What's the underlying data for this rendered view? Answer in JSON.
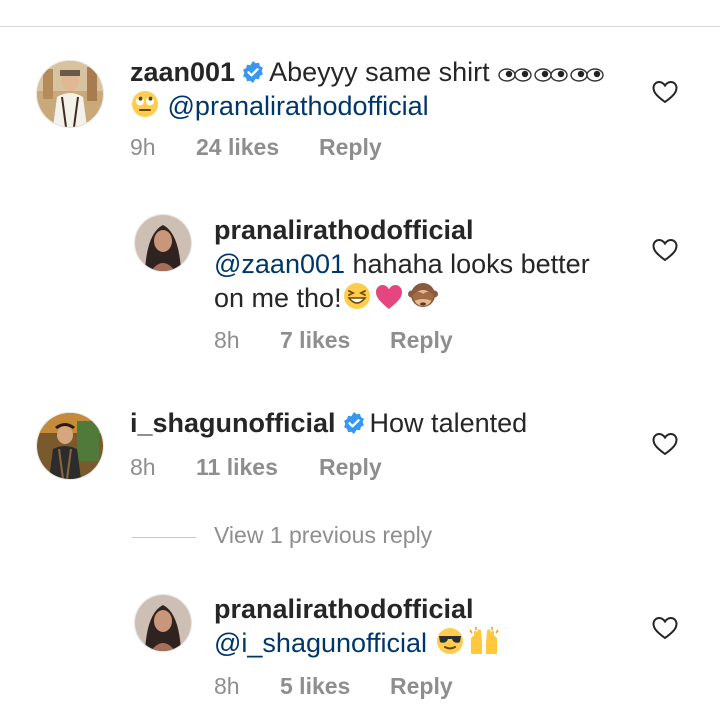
{
  "comments": [
    {
      "username": "zaan001",
      "verified": true,
      "text": "Abeyyy same shirt",
      "text_emojis": [
        "eyes-emoji",
        "eyes-emoji",
        "eyes-emoji"
      ],
      "line2_emoji": "rolling-eyes-emoji",
      "mention": "@pranalirathodofficial",
      "time": "9h",
      "likes": "24 likes",
      "reply": "Reply"
    },
    {
      "username": "pranalirathodofficial",
      "mention": "@zaan001",
      "text1": " hahaha looks better",
      "text2": "on me tho!",
      "text_emojis": [
        "grinning-squinting-emoji",
        "pink-heart-emoji",
        "see-no-evil-monkey-emoji"
      ],
      "time": "8h",
      "likes": "7 likes",
      "reply": "Reply"
    },
    {
      "username": "i_shagunofficial",
      "verified": true,
      "text": "How talented",
      "time": "8h",
      "likes": "11 likes",
      "reply": "Reply"
    },
    {
      "username": "pranalirathodofficial",
      "mention": "@i_shagunofficial",
      "text_emojis": [
        "sunglasses-emoji",
        "raised-hands-emoji"
      ],
      "time": "8h",
      "likes": "5 likes",
      "reply": "Reply"
    }
  ],
  "view_previous": "View 1 previous reply",
  "colors": {
    "mention": "#00376b",
    "meta": "#8e8e8e",
    "verified": "#3897f0",
    "text": "#262626"
  }
}
